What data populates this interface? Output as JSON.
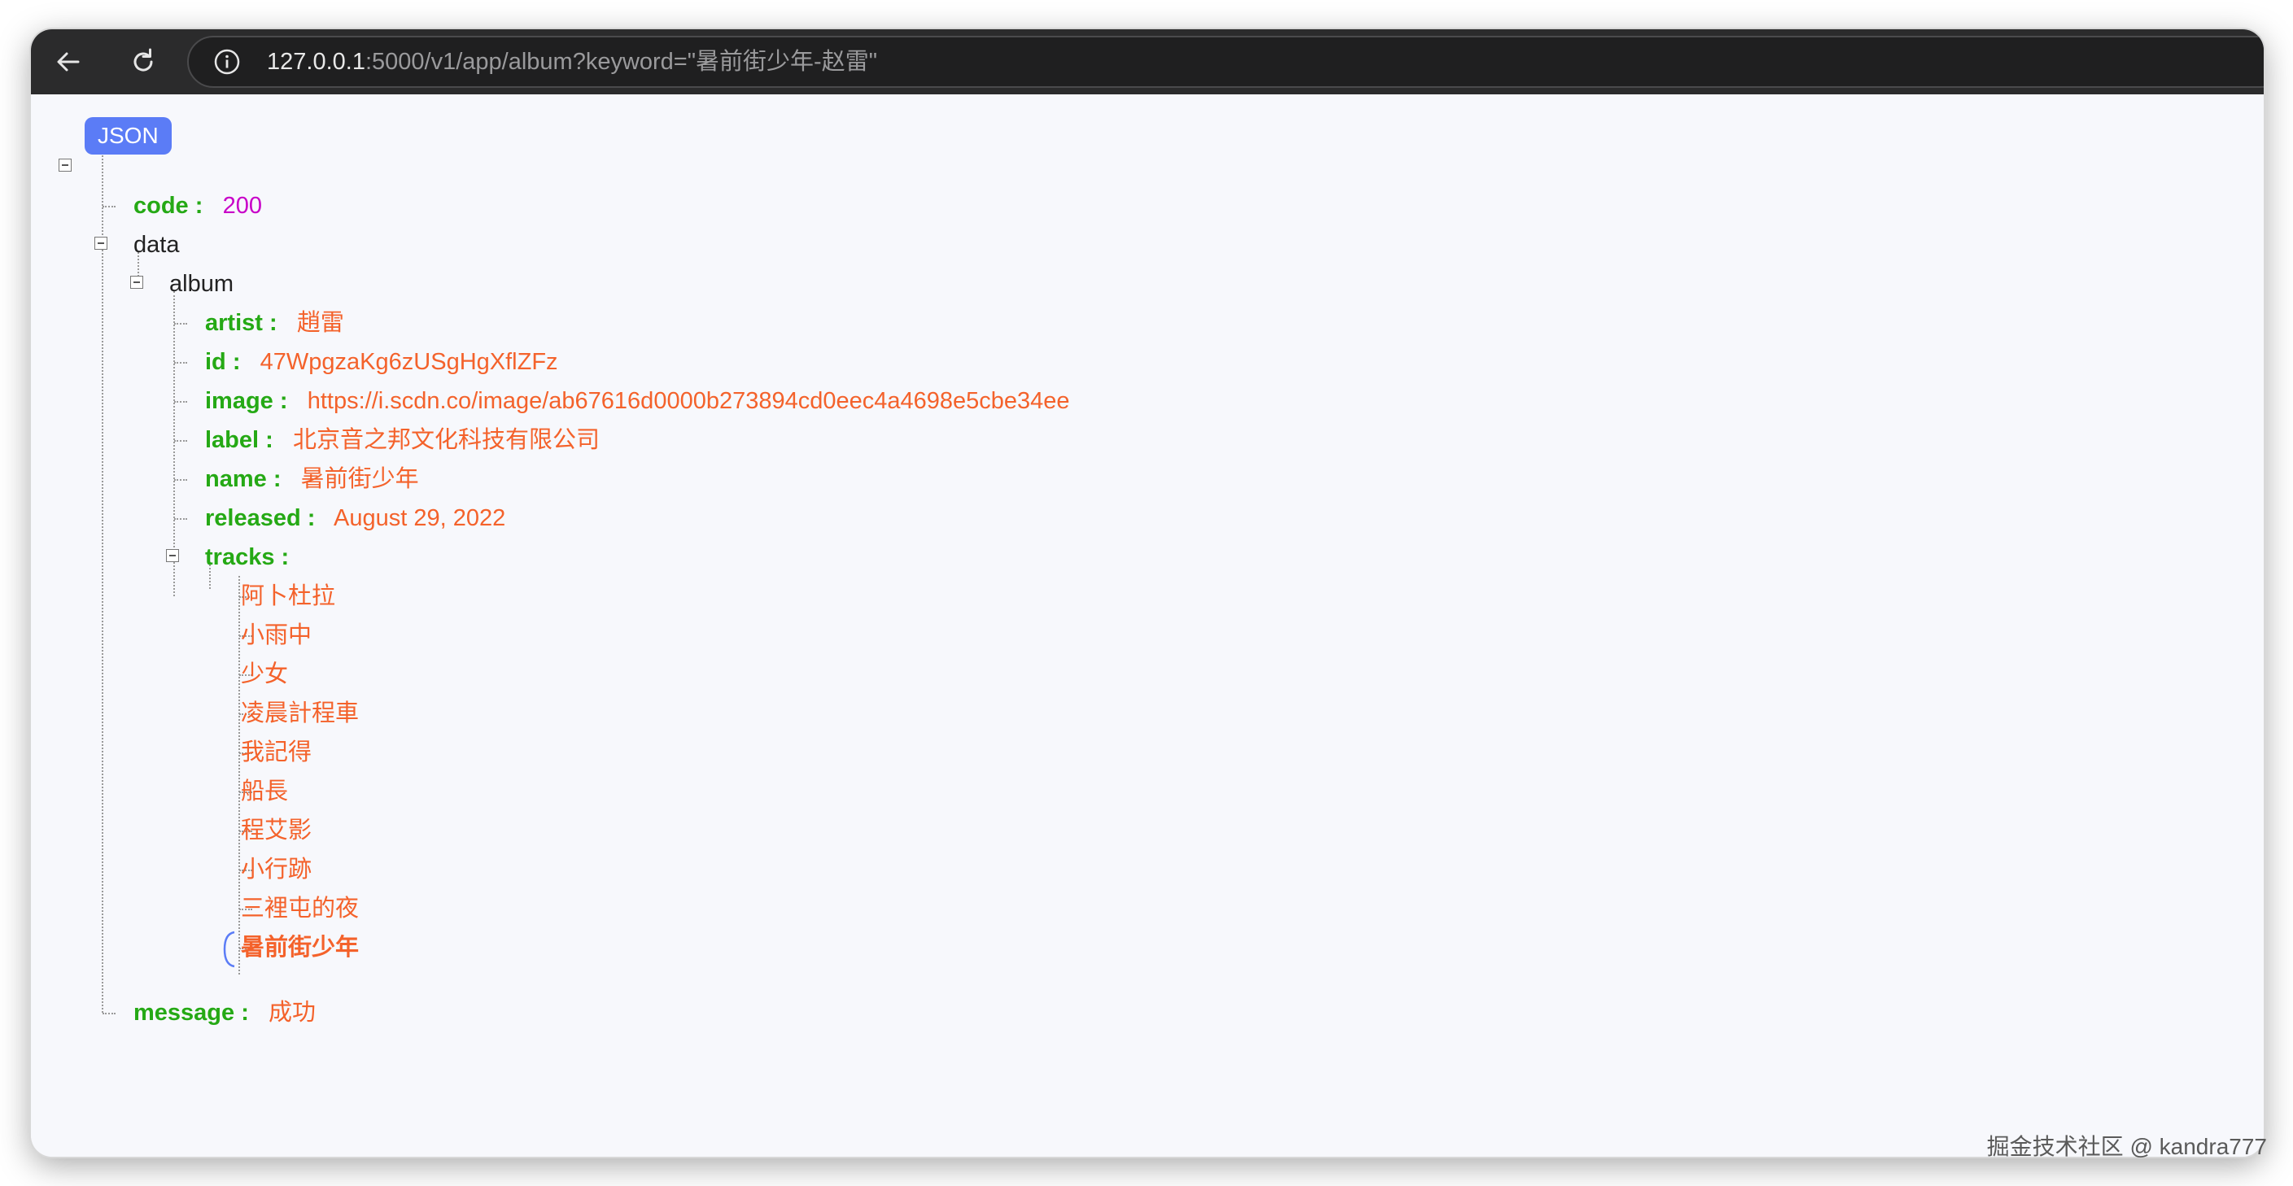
{
  "browser": {
    "url_host": "127.0.0.1",
    "url_rest": ":5000/v1/app/album?keyword=\"暑前街少年-赵雷\""
  },
  "tree": {
    "root_label": "JSON",
    "code_key": "code :",
    "code_value": "200",
    "data_key": "data",
    "album_key": "album",
    "artist_key": "artist :",
    "artist_value": "趙雷",
    "id_key": "id :",
    "id_value": "47WpgzaKg6zUSgHgXflZFz",
    "image_key": "image :",
    "image_value": "https://i.scdn.co/image/ab67616d0000b273894cd0eec4a4698e5cbe34ee",
    "label_key": "label :",
    "label_value": "北京音之邦文化科技有限公司",
    "name_key": "name :",
    "name_value": "暑前街少年",
    "released_key": "released :",
    "released_value": "August 29, 2022",
    "tracks_key": "tracks :",
    "tracks": [
      "阿卜杜拉",
      "小雨中",
      "少女",
      "凌晨計程車",
      "我記得",
      "船長",
      "程艾影",
      "小行跡",
      "三裡屯的夜",
      "暑前街少年"
    ],
    "message_key": "message :",
    "message_value": "成功"
  },
  "watermark": "掘金技术社区 @ kandra777"
}
